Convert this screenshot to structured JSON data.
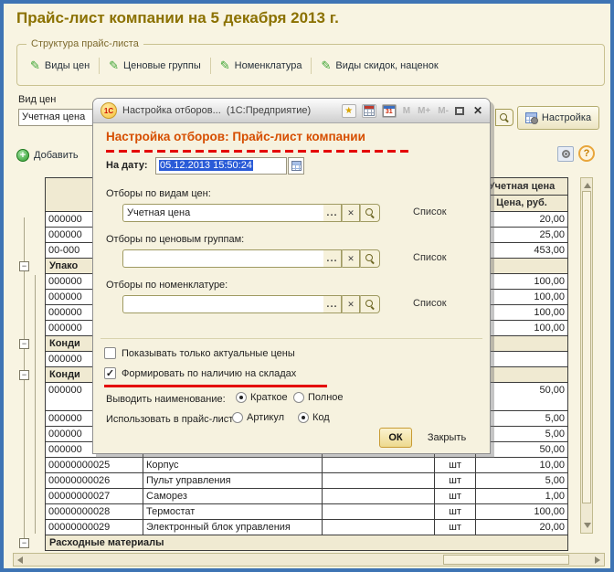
{
  "window": {
    "title": "Прайс-лист компании на 5 декабря 2013 г."
  },
  "structure_group": {
    "legend": "Структура прайс-листа",
    "buttons": [
      {
        "label": "Виды цен"
      },
      {
        "label": "Ценовые группы"
      },
      {
        "label": "Номенклатура"
      },
      {
        "label": "Виды скидок, наценок"
      }
    ]
  },
  "filters_bar": {
    "price_type_label": "Вид цен",
    "price_type_value": "Учетная цена",
    "settings_button": "Настройка",
    "add_button": "Добавить"
  },
  "dialog": {
    "titlebar": {
      "logo_text": "1С",
      "title": "Настройка отборов...",
      "app_name": "(1С:Предприятие)",
      "calendar_day": "31",
      "memory_buttons": [
        "M",
        "M+",
        "M-"
      ]
    },
    "heading": "Настройка отборов: Прайс-лист компании",
    "date": {
      "label": "На дату:",
      "value": "05.12.2013 15:50:24"
    },
    "filters": [
      {
        "label": "Отборы по видам цен:",
        "value": "Учетная цена",
        "mode": "Список"
      },
      {
        "label": "Отборы по ценовым группам:",
        "value": "",
        "mode": "Список"
      },
      {
        "label": "Отборы по номенклатуре:",
        "value": "",
        "mode": "Список"
      }
    ],
    "checkboxes": [
      {
        "label": "Показывать только актуальные цены",
        "checked": false
      },
      {
        "label": "Формировать по наличию на складах",
        "checked": true,
        "underlined": true
      }
    ],
    "radio_groups": [
      {
        "label": "Выводить наименование:",
        "options": [
          {
            "label": "Краткое",
            "selected": true
          },
          {
            "label": "Полное",
            "selected": false
          }
        ]
      },
      {
        "label": "Использовать в прайс-листе:",
        "options": [
          {
            "label": "Артикул",
            "selected": false
          },
          {
            "label": "Код",
            "selected": true
          }
        ]
      }
    ],
    "buttons": {
      "ok": "ОК",
      "close": "Закрыть"
    }
  },
  "table": {
    "price_header": {
      "line1": "Учетная цена",
      "line2": "Цена, руб."
    },
    "rows": [
      {
        "type": "item",
        "code": "000000",
        "name": "",
        "unit": "",
        "price": "20,00"
      },
      {
        "type": "item",
        "code": "000000",
        "name": "",
        "unit": "",
        "price": "25,00"
      },
      {
        "type": "item",
        "code": "00-000",
        "name": "",
        "unit": "",
        "price": "453,00"
      },
      {
        "type": "group",
        "label": "Упако"
      },
      {
        "type": "item",
        "code": "000000",
        "name": "",
        "unit": "",
        "price": "100,00"
      },
      {
        "type": "item",
        "code": "000000",
        "name": "",
        "unit": "",
        "price": "100,00"
      },
      {
        "type": "item",
        "code": "000000",
        "name": "",
        "unit": "",
        "price": "100,00"
      },
      {
        "type": "item",
        "code": "000000",
        "name": "",
        "unit": "",
        "price": "100,00"
      },
      {
        "type": "group",
        "label": "Конди"
      },
      {
        "type": "item",
        "code": "000000",
        "name": "",
        "unit": "",
        "price": ""
      },
      {
        "type": "group",
        "label": "Конди"
      },
      {
        "type": "item",
        "code": "000000",
        "name": "",
        "unit": "",
        "price": "50,00",
        "tall": true
      },
      {
        "type": "item",
        "code": "000000",
        "name": "",
        "unit": "",
        "price": "5,00"
      },
      {
        "type": "item",
        "code": "000000",
        "name": "",
        "unit": "",
        "price": "5,00"
      },
      {
        "type": "item",
        "code": "000000",
        "name": "",
        "unit": "",
        "price": "50,00"
      },
      {
        "type": "item",
        "code": "00000000025",
        "name": "Корпус",
        "unit": "шт",
        "price": "10,00"
      },
      {
        "type": "item",
        "code": "00000000026",
        "name": "Пульт управления",
        "unit": "шт",
        "price": "5,00"
      },
      {
        "type": "item",
        "code": "00000000027",
        "name": "Саморез",
        "unit": "шт",
        "price": "1,00"
      },
      {
        "type": "item",
        "code": "00000000028",
        "name": "Термостат",
        "unit": "шт",
        "price": "100,00"
      },
      {
        "type": "item",
        "code": "00000000029",
        "name": "Электронный блок управления",
        "unit": "шт",
        "price": "20,00"
      },
      {
        "type": "group",
        "label": "Расходные материалы"
      }
    ]
  }
}
